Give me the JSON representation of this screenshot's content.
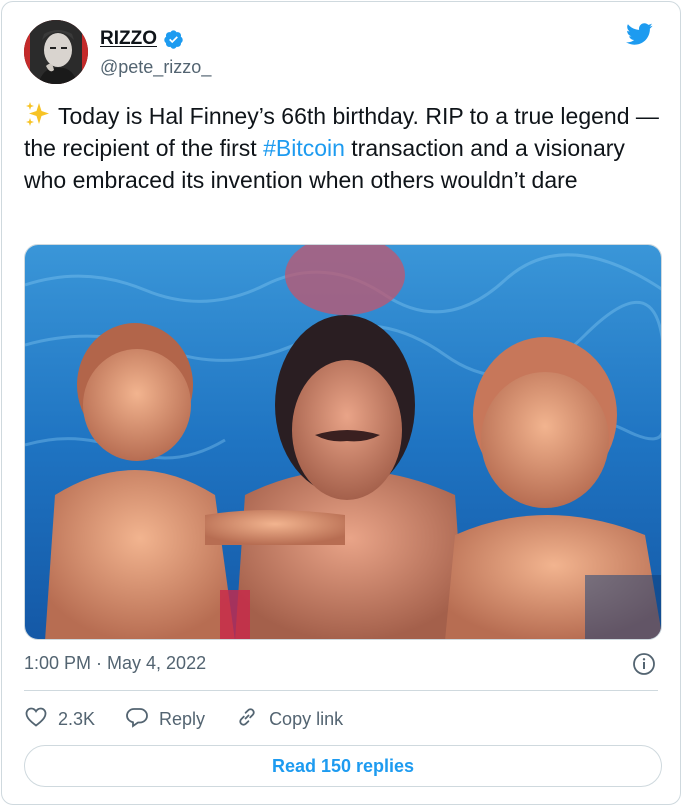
{
  "author": {
    "name": "RIZZO",
    "handle": "@pete_rizzo_"
  },
  "icons": {
    "verified": "verified-badge-icon",
    "brand": "twitter-bird-icon",
    "sparkles": "sparkles-emoji",
    "info": "info-icon",
    "like": "heart-icon",
    "reply": "speech-bubble-icon",
    "copy": "link-icon"
  },
  "tweet": {
    "text_part1": "Today is Hal Finney’s 66th birthday. RIP to a true legend — the recipient of the first ",
    "hashtag": "#Bitcoin",
    "text_part2": " transaction and a visionary who embraced its invention when others wouldn’t dare",
    "timestamp": "1:00 PM · May 4, 2022"
  },
  "actions": {
    "likes": "2.3K",
    "reply_label": "Reply",
    "copy_label": "Copy link"
  },
  "replies_button": "Read 150 replies",
  "colors": {
    "accent": "#1d9bf0",
    "text": "#0f1419",
    "muted": "#536471",
    "border": "#cfd9de"
  }
}
